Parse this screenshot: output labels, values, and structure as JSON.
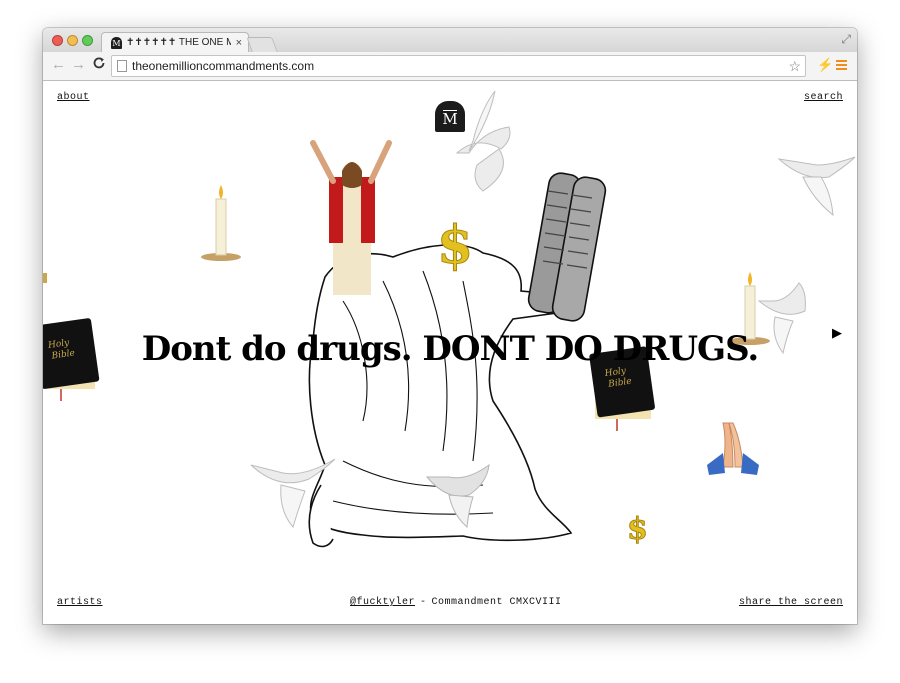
{
  "browser": {
    "tab": {
      "favicon_letter": "M",
      "title": "✝✝✝✝✝✝ THE ONE MILLION C",
      "close_glyph": "×"
    },
    "toolbar": {
      "back_glyph": "←",
      "forward_glyph": "→",
      "reload_glyph": "C",
      "url": "theonemillioncommandments.com",
      "star_glyph": "☆",
      "extension_glyph": "⚡",
      "fullscreen_glyph": "⤢"
    }
  },
  "page": {
    "nav": {
      "about": "about",
      "search": "search"
    },
    "logo_letter": "M",
    "commandment_text": "Dont do drugs. DONT DO DRUGS.",
    "next_glyph": "▶",
    "footer": {
      "artists": "artists",
      "author": "@fucktyler",
      "separator": "-",
      "commandment_number": "Commandment CMXCVIII",
      "share": "share the screen"
    },
    "decorations": {
      "bible_text_line1": "Holy",
      "bible_text_line2": "Bible",
      "dollar_glyph": "$"
    }
  }
}
